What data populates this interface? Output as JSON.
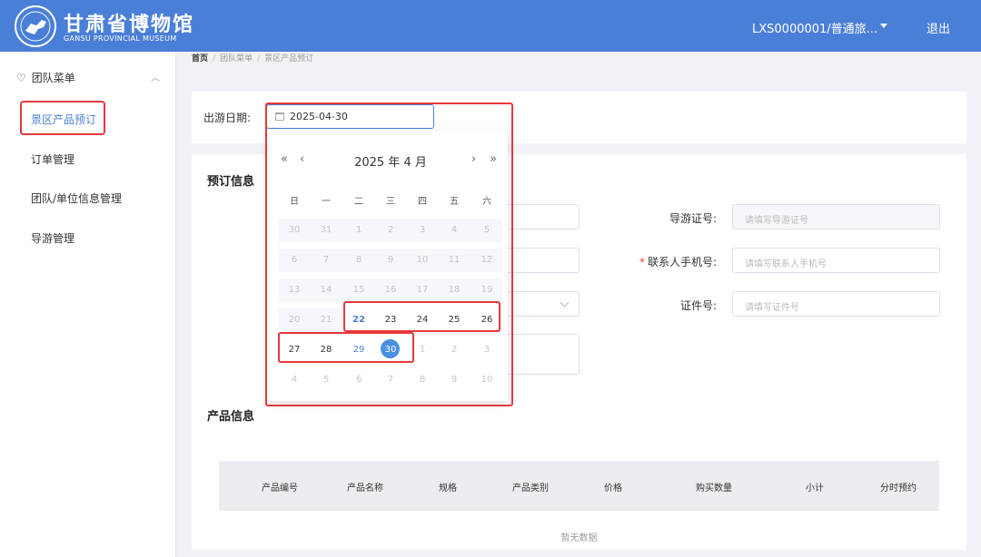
{
  "header": {
    "logo_cn": "甘肃省博物馆",
    "logo_en": "GANSU PROVINCIAL MUSEUM",
    "user": "LXS0000001/普通旅...",
    "logout": "退出"
  },
  "sidebar": {
    "group_label": "团队菜单",
    "items": [
      {
        "label": "景区产品预订",
        "active": true
      },
      {
        "label": "订单管理"
      },
      {
        "label": "团队/单位信息管理"
      },
      {
        "label": "导游管理"
      }
    ]
  },
  "breadcrumb": [
    "首页",
    "团队菜单",
    "景区产品预订"
  ],
  "date_filter": {
    "label": "出游日期:",
    "value": "2025-04-30"
  },
  "booking": {
    "title": "预订信息",
    "fields": [
      {
        "label": "导游证号:",
        "placeholder": "请填写导游证号",
        "required": false
      },
      {
        "label": "联系人手机号:",
        "placeholder": "请填写联系人手机号",
        "required": true
      },
      {
        "label": "证件号:",
        "placeholder": "请填写证件号",
        "required": false
      }
    ]
  },
  "products": {
    "title": "产品信息",
    "columns": [
      "产品编号",
      "产品名称",
      "规格",
      "产品类别",
      "价格",
      "购买数量",
      "小计",
      "分时预约"
    ],
    "empty_text": "暂无数据"
  },
  "calendar": {
    "title": "2025 年  4 月",
    "nav": {
      "prev_year": "«",
      "prev_month": "‹",
      "next_month": "›",
      "next_year": "»"
    },
    "weekdays": [
      "日",
      "一",
      "二",
      "三",
      "四",
      "五",
      "六"
    ],
    "weeks": [
      [
        "30",
        "31",
        "1",
        "2",
        "3",
        "4",
        "5"
      ],
      [
        "6",
        "7",
        "8",
        "9",
        "10",
        "11",
        "12"
      ],
      [
        "13",
        "14",
        "15",
        "16",
        "17",
        "18",
        "19"
      ],
      [
        "20",
        "21",
        "22",
        "23",
        "24",
        "25",
        "26"
      ],
      [
        "27",
        "28",
        "29",
        "30",
        "1",
        "2",
        "3"
      ],
      [
        "4",
        "5",
        "6",
        "7",
        "8",
        "9",
        "10"
      ]
    ],
    "today": "22",
    "selected": "30",
    "selection_color": "#4a90e2"
  },
  "colors": {
    "header": "#4a7fd8",
    "highlight": "#e5383b",
    "accent": "#4a7fd8"
  }
}
